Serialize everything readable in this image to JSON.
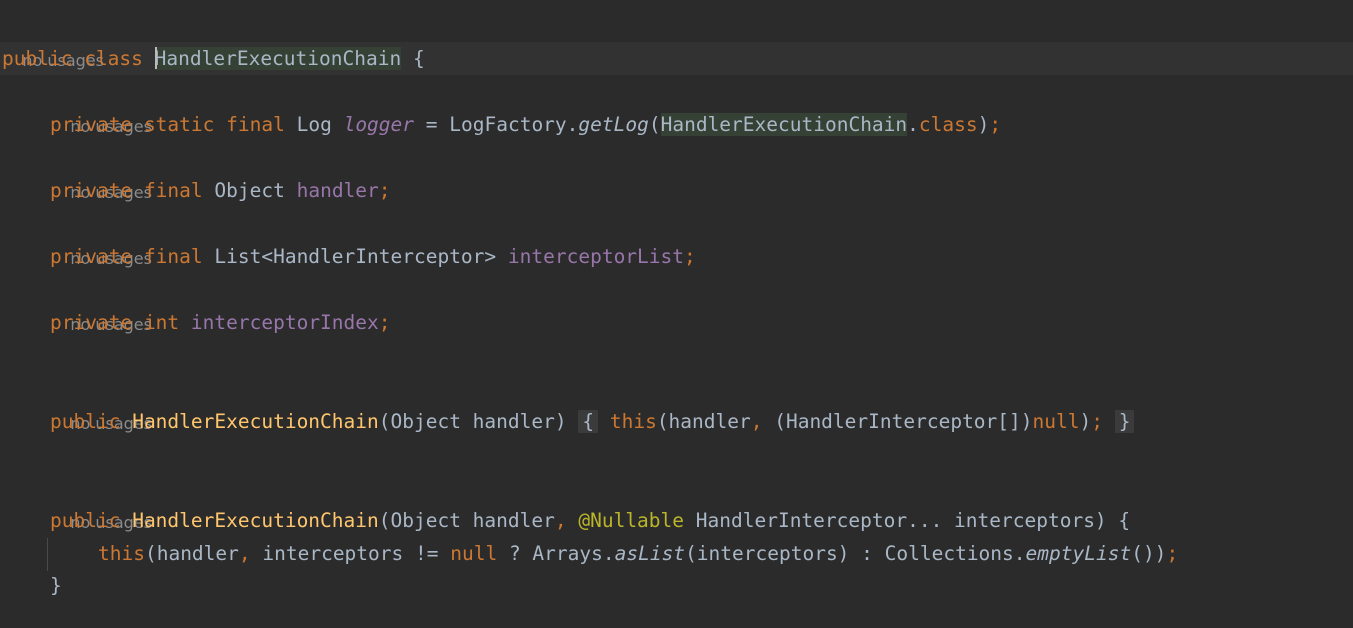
{
  "hints": {
    "usage_label": "no usages"
  },
  "code": {
    "l1": {
      "public": "public",
      "class": "class",
      "name": "HandlerExecutionChain",
      "brace": "{"
    },
    "l2": {
      "private": "private",
      "static": "static",
      "final": "final",
      "type": "Log",
      "field": "logger",
      "eq": " = ",
      "factory": "LogFactory.",
      "method": "getLog",
      "open": "(",
      "arg": "HandlerExecutionChain",
      "dot": ".",
      "classkw": "class",
      "close": ")",
      "semi": ";"
    },
    "l3": {
      "private": "private",
      "final": "final",
      "type": "Object",
      "field": "handler",
      "semi": ";"
    },
    "l4": {
      "private": "private",
      "final": "final",
      "type": "List<HandlerInterceptor>",
      "field": "interceptorList",
      "semi": ";"
    },
    "l5": {
      "private": "private",
      "int": "int",
      "field": "interceptorIndex",
      "semi": ";"
    },
    "l6": {
      "public": "public",
      "ctor": "HandlerExecutionChain",
      "params": "(Object handler)",
      "fold_open": "{",
      "this": "this",
      "args_a": "(handler",
      "comma": ",",
      "args_b": " (HandlerInterceptor[])",
      "null": "null",
      "args_c": ")",
      "semi": ";",
      "fold_close": "}"
    },
    "l7": {
      "public": "public",
      "ctor": "HandlerExecutionChain",
      "p_a": "(Object handler",
      "comma": ",",
      "annot": "@Nullable",
      "p_b": " HandlerInterceptor... interceptors) {"
    },
    "l8": {
      "this": "this",
      "a": "(handler",
      "comma": ",",
      "b": " interceptors != ",
      "null": "null",
      "c": " ? Arrays.",
      "aslist": "asList",
      "d": "(interceptors) : Collections.",
      "empty": "emptyList",
      "e": "())",
      "semi": ";"
    },
    "l9": {
      "brace": "}"
    }
  }
}
